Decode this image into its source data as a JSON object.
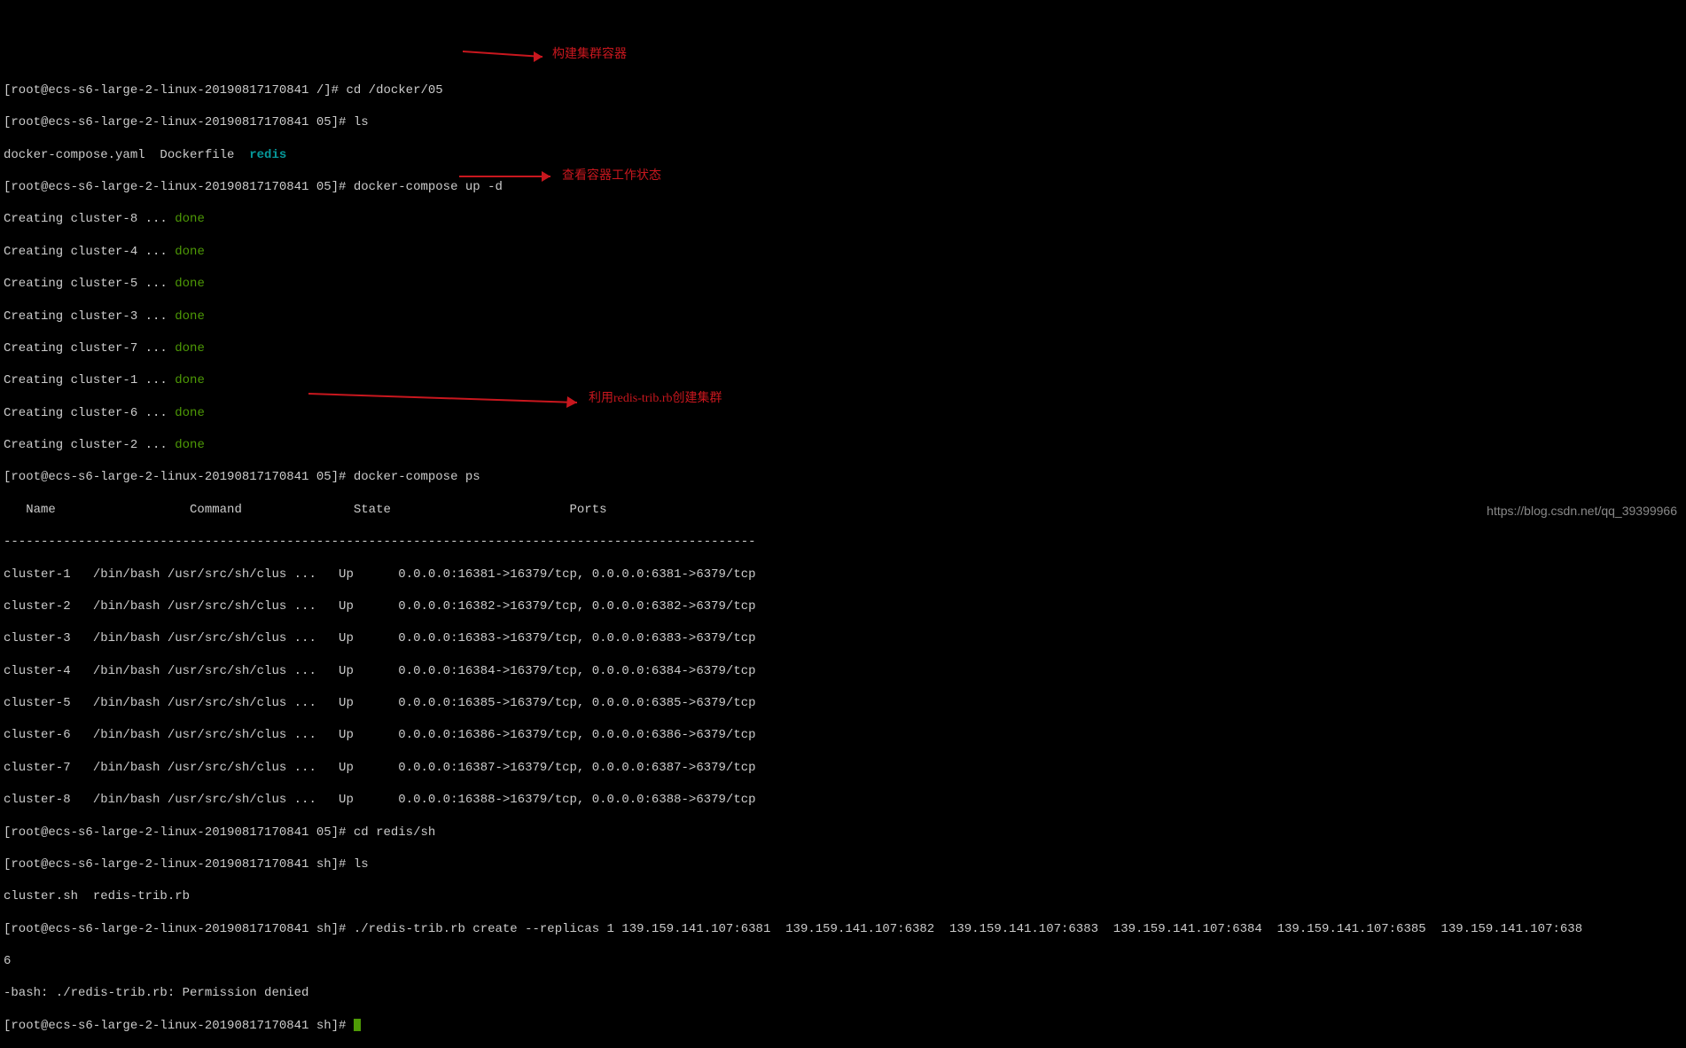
{
  "host": "ecs-s6-large-2-linux-20190817170841",
  "user": "root",
  "lines": {
    "cd_docker": "[root@ecs-s6-large-2-linux-20190817170841 /]# cd /docker/05",
    "ls1": "[root@ecs-s6-large-2-linux-20190817170841 05]# ls",
    "ls1_out1": "docker-compose.yaml  Dockerfile  ",
    "ls1_out_redis": "redis",
    "compose_up": "[root@ecs-s6-large-2-linux-20190817170841 05]# docker-compose up -d",
    "creating": [
      "Creating cluster-8 ... ",
      "Creating cluster-4 ... ",
      "Creating cluster-5 ... ",
      "Creating cluster-3 ... ",
      "Creating cluster-7 ... ",
      "Creating cluster-1 ... ",
      "Creating cluster-6 ... ",
      "Creating cluster-2 ... "
    ],
    "done": "done",
    "compose_ps": "[root@ecs-s6-large-2-linux-20190817170841 05]# docker-compose ps",
    "ps_header": "   Name                  Command               State                        Ports                     ",
    "ps_sep": "-----------------------------------------------------------------------------------------------------",
    "ps_rows": [
      "cluster-1   /bin/bash /usr/src/sh/clus ...   Up      0.0.0.0:16381->16379/tcp, 0.0.0.0:6381->6379/tcp",
      "cluster-2   /bin/bash /usr/src/sh/clus ...   Up      0.0.0.0:16382->16379/tcp, 0.0.0.0:6382->6379/tcp",
      "cluster-3   /bin/bash /usr/src/sh/clus ...   Up      0.0.0.0:16383->16379/tcp, 0.0.0.0:6383->6379/tcp",
      "cluster-4   /bin/bash /usr/src/sh/clus ...   Up      0.0.0.0:16384->16379/tcp, 0.0.0.0:6384->6379/tcp",
      "cluster-5   /bin/bash /usr/src/sh/clus ...   Up      0.0.0.0:16385->16379/tcp, 0.0.0.0:6385->6379/tcp",
      "cluster-6   /bin/bash /usr/src/sh/clus ...   Up      0.0.0.0:16386->16379/tcp, 0.0.0.0:6386->6379/tcp",
      "cluster-7   /bin/bash /usr/src/sh/clus ...   Up      0.0.0.0:16387->16379/tcp, 0.0.0.0:6387->6379/tcp",
      "cluster-8   /bin/bash /usr/src/sh/clus ...   Up      0.0.0.0:16388->16379/tcp, 0.0.0.0:6388->6379/tcp"
    ],
    "cd_redis": "[root@ecs-s6-large-2-linux-20190817170841 05]# cd redis/sh",
    "ls2": "[root@ecs-s6-large-2-linux-20190817170841 sh]# ls",
    "ls2_out": "cluster.sh  redis-trib.rb",
    "redis_trib": "[root@ecs-s6-large-2-linux-20190817170841 sh]# ./redis-trib.rb create --replicas 1 139.159.141.107:6381  139.159.141.107:6382  139.159.141.107:6383  139.159.141.107:6384  139.159.141.107:6385  139.159.141.107:638",
    "redis_trib2": "6",
    "perm_denied": "-bash: ./redis-trib.rb: Permission denied",
    "final_prompt": "[root@ecs-s6-large-2-linux-20190817170841 sh]# "
  },
  "annotations": {
    "a1": "构建集群容器",
    "a2": "查看容器工作状态",
    "a3": "利用redis-trib.rb创建集群"
  },
  "watermark": "https://blog.csdn.net/qq_39399966"
}
